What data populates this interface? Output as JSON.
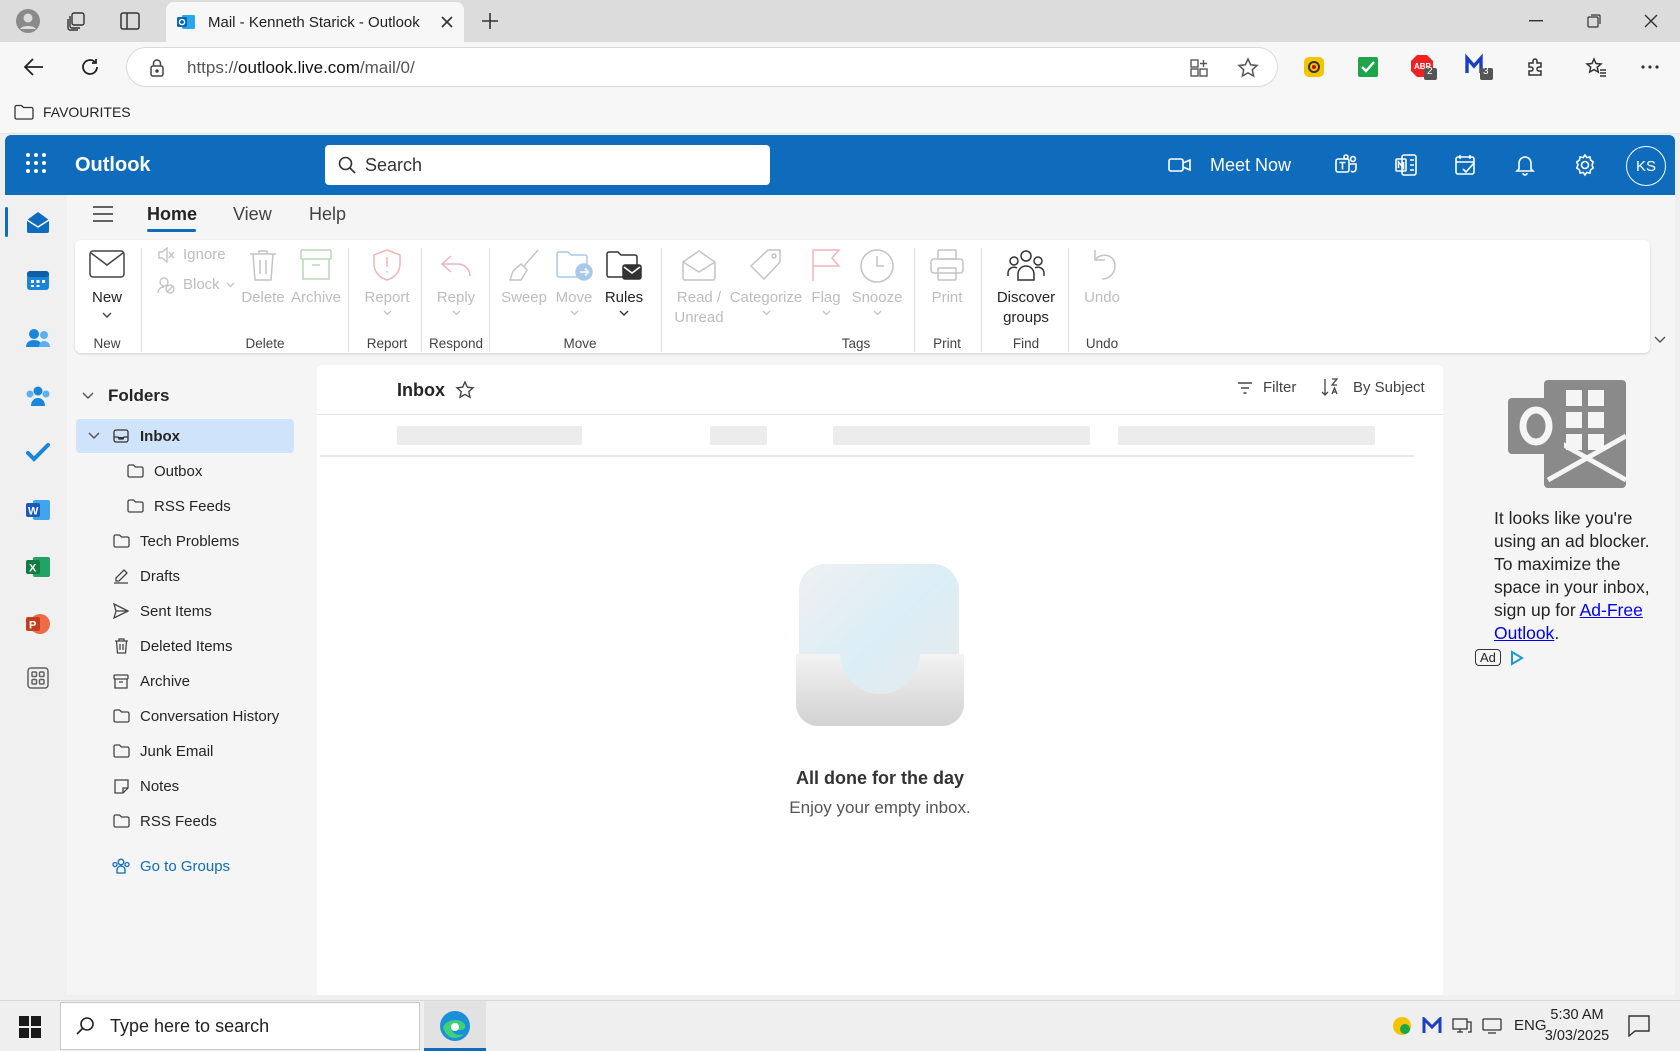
{
  "browser": {
    "tab_title": "Mail - Kenneth Starick - Outlook",
    "url_prefix": "https://",
    "url_host": "outlook.live.com",
    "url_path": "/mail/0/",
    "favourites_label": "FAVOURITES",
    "ext_badges": {
      "abp": "2",
      "m": "3"
    }
  },
  "header": {
    "app_name": "Outlook",
    "search_placeholder": "Search",
    "meet_now": "Meet Now",
    "avatar_initials": "KS"
  },
  "ribbon": {
    "tabs": [
      "Home",
      "View",
      "Help"
    ],
    "new": "New",
    "ignore": "Ignore",
    "block": "Block",
    "delete": "Delete",
    "archive": "Archive",
    "report": "Report",
    "reply": "Reply",
    "sweep": "Sweep",
    "move": "Move",
    "rules": "Rules",
    "read_unread_1": "Read /",
    "read_unread_2": "Unread",
    "categorize": "Categorize",
    "flag": "Flag",
    "snooze": "Snooze",
    "print": "Print",
    "discover_1": "Discover",
    "discover_2": "groups",
    "undo": "Undo",
    "groups": {
      "new": "New",
      "delete": "Delete",
      "report": "Report",
      "respond": "Respond",
      "move": "Move",
      "tags": "Tags",
      "print": "Print",
      "find": "Find",
      "undo": "Undo"
    }
  },
  "folders": {
    "heading": "Folders",
    "items": [
      "Inbox",
      "Outbox",
      "RSS Feeds",
      "Tech Problems",
      "Drafts",
      "Sent Items",
      "Deleted Items",
      "Archive",
      "Conversation History",
      "Junk Email",
      "Notes",
      "RSS Feeds"
    ],
    "go_to_groups": "Go to Groups"
  },
  "list": {
    "title": "Inbox",
    "filter": "Filter",
    "sort": "By Subject",
    "empty_title": "All done for the day",
    "empty_sub": "Enjoy your empty inbox."
  },
  "ad": {
    "text1": "It looks like you're",
    "text2": "using an ad blocker.",
    "text3": "To maximize the",
    "text4": "space in your inbox,",
    "text5": "sign up for ",
    "link1": "Ad-Free",
    "link2": "Outlook",
    "text6": ".",
    "badge": "Ad"
  },
  "taskbar": {
    "search_placeholder": "Type here to search",
    "lang": "ENG",
    "time": "5:30 AM",
    "date": "3/03/2025"
  },
  "colors": {
    "brand": "#0f6cbd",
    "selected": "#cfe4fa"
  }
}
